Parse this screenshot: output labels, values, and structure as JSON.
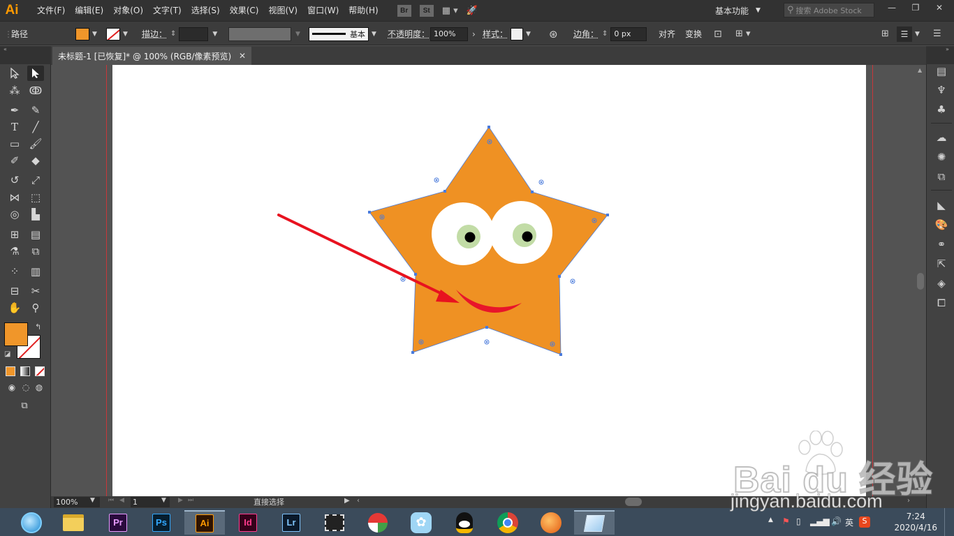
{
  "menubar": {
    "logo": "Ai",
    "items": [
      "文件(F)",
      "编辑(E)",
      "对象(O)",
      "文字(T)",
      "选择(S)",
      "效果(C)",
      "视图(V)",
      "窗口(W)",
      "帮助(H)"
    ],
    "bridge": "Br",
    "stock": "St",
    "workspace": "基本功能",
    "search_placeholder": "搜索 Adobe Stock",
    "win_min": "—",
    "win_restore": "❐",
    "win_close": "✕"
  },
  "controlbar": {
    "object_type": "路径",
    "fill_color": "#f0962a",
    "stroke_label": "描边：",
    "stroke_profile": "基本",
    "opacity_label": "不透明度：",
    "opacity_value": "100%",
    "style_label": "样式：",
    "corner_label": "边角：",
    "corner_value": "0 px",
    "align_label": "对齐",
    "transform_label": "变换"
  },
  "document": {
    "tab_title": "未标题-1 [已恢复]* @ 100% (RGB/像素预览)",
    "close": "✕"
  },
  "status": {
    "zoom": "100%",
    "page": "1",
    "mode": "直接选择"
  },
  "artwork": {
    "star_color": "#ef9123",
    "eye_white": "#ffffff",
    "iris_color": "#c2dca6",
    "pupil_color": "#000000",
    "mouth_color": "#e8152a",
    "selection_color": "#4a7bdc",
    "arrow_color": "#e8121f"
  },
  "tools": {
    "fill_color": "#f0962a",
    "stroke_none": true
  },
  "taskbar": {
    "apps": [
      "browser",
      "file-explorer",
      "Pr",
      "Ps",
      "Ai",
      "Id",
      "Lr",
      "video",
      "games",
      "bird",
      "qq",
      "chrome",
      "fox",
      "notes"
    ],
    "ime": "英",
    "time": "7:24",
    "date": "2020/4/16"
  },
  "watermark": {
    "logo": "Bai du 经验",
    "url": "jingyan.baidu.com"
  }
}
